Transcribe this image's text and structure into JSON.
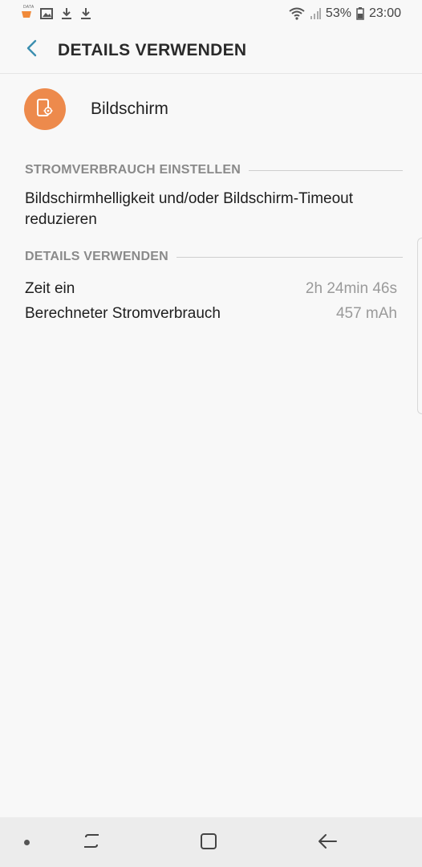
{
  "status_bar": {
    "data_tag": "DATA",
    "battery_percent": "53%",
    "time": "23:00",
    "icons": [
      "data-saver-icon",
      "image-icon",
      "download-icon",
      "download-icon",
      "wifi-icon",
      "signal-icon",
      "battery-icon"
    ]
  },
  "header": {
    "title": "DETAILS VERWENDEN",
    "back_icon": "chevron-left-icon"
  },
  "app": {
    "name": "Bildschirm",
    "icon": "screen-settings-icon",
    "icon_bg_color": "#ed8a4c"
  },
  "sections": {
    "power": {
      "title": "STROMVERBRAUCH EINSTELLEN",
      "tip": "Bildschirmhelligkeit und/oder Bildschirm-Timeout reduzieren"
    },
    "details": {
      "title": "DETAILS VERWENDEN",
      "rows": [
        {
          "label": "Zeit ein",
          "value": "2h 24min 46s"
        },
        {
          "label": "Berechneter Stromverbrauch",
          "value": "457 mAh"
        }
      ]
    }
  },
  "nav_bar": {
    "icons": [
      "dot-icon",
      "recent-apps-icon",
      "home-icon",
      "back-icon"
    ]
  }
}
